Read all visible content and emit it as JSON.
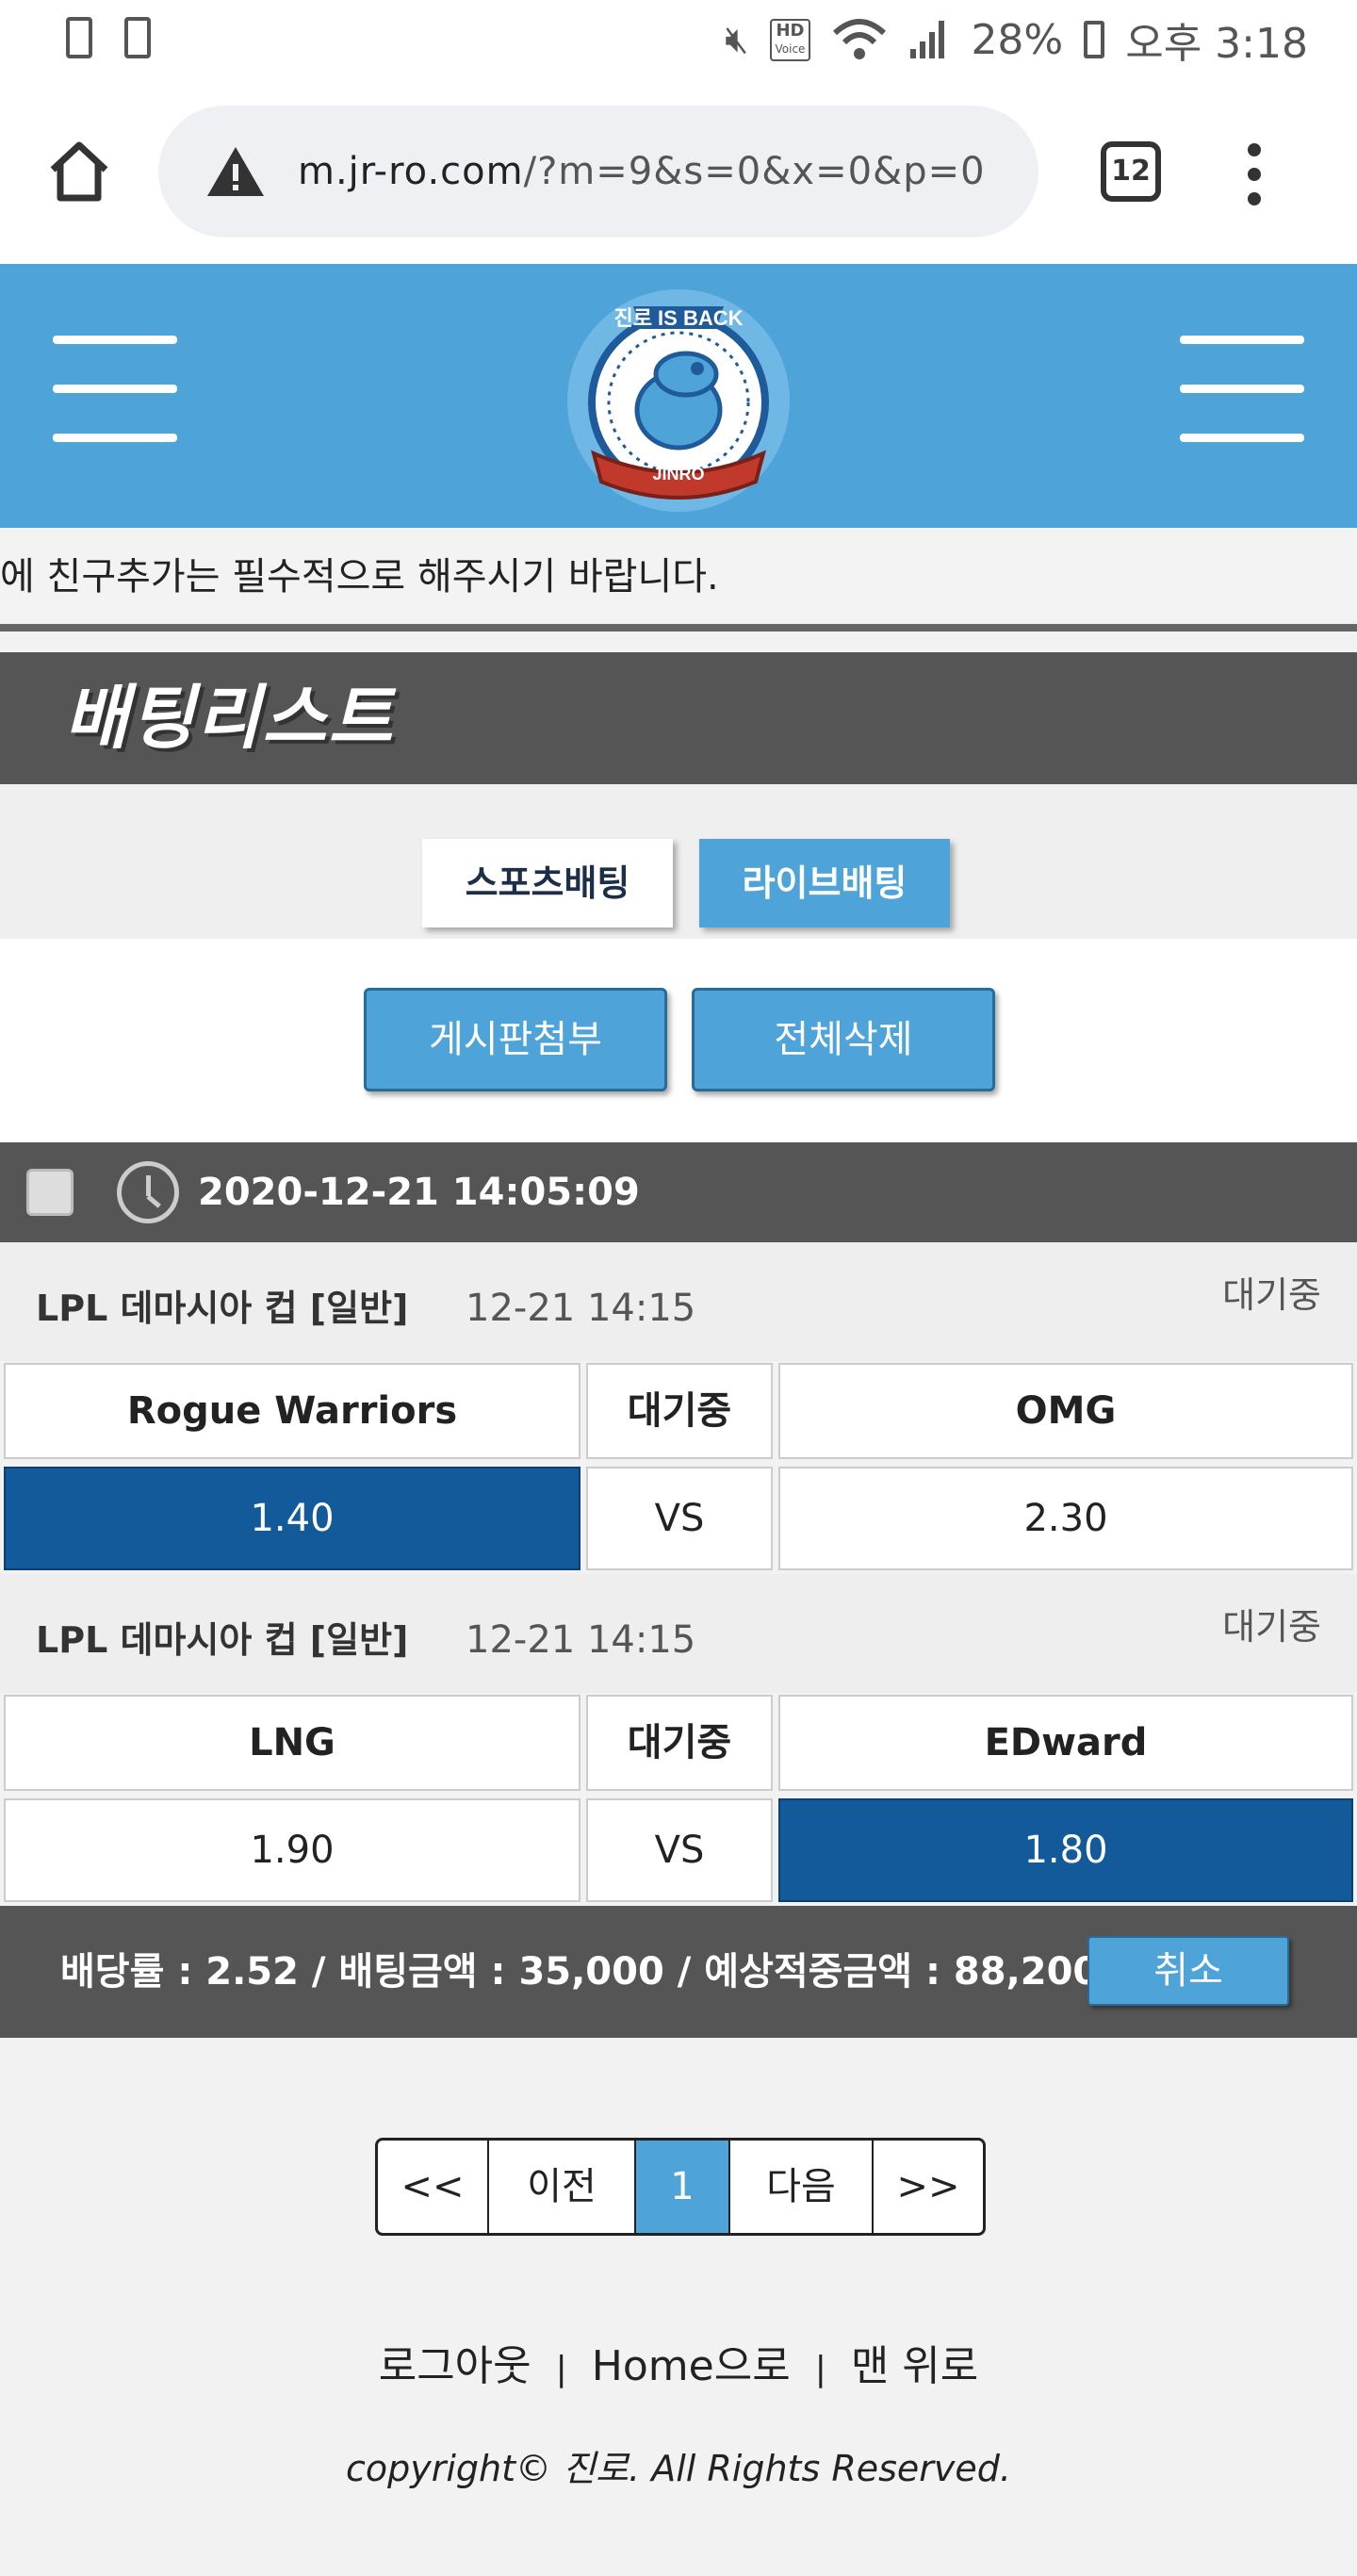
{
  "status_bar": {
    "battery": "28%",
    "time": "오후 3:18",
    "hd_label": "HD",
    "voice_label": "Voice"
  },
  "browser": {
    "url_host": "m.jr-ro.com",
    "url_rest": "/?m=9&s=0&x=0&p=0",
    "tab_count": "12"
  },
  "header": {
    "logo_top_text": "진로 IS BACK",
    "logo_ribbon_text": "JINRO"
  },
  "notice": "에 친구추가는 필수적으로 해주시기 바랍니다.",
  "page_title": "배팅리스트",
  "tabs": [
    {
      "label": "스포츠배팅",
      "active": false
    },
    {
      "label": "라이브배팅",
      "active": true
    }
  ],
  "actions": {
    "attach_label": "게시판첨부",
    "delete_all_label": "전체삭제"
  },
  "slip": {
    "datetime": "2020-12-21 14:05:09",
    "games": [
      {
        "league": "LPL 데마시아 컵  [일반]",
        "time": "12-21 14:15",
        "status": "대기중",
        "home": "Rogue Warriors",
        "mid": "대기중",
        "away": "OMG",
        "home_odds": "1.40",
        "vs": "VS",
        "away_odds": "2.30",
        "selected": "home"
      },
      {
        "league": "LPL 데마시아 컵  [일반]",
        "time": "12-21 14:15",
        "status": "대기중",
        "home": "LNG",
        "mid": "대기중",
        "away": "EDward",
        "home_odds": "1.90",
        "vs": "VS",
        "away_odds": "1.80",
        "selected": "away"
      }
    ],
    "summary": "배당률 : 2.52 / 배팅금액 : 35,000 / 예상적중금액 : 88,200",
    "cancel_label": "취소"
  },
  "pagination": {
    "first": "<<",
    "prev": "이전",
    "current": "1",
    "next": "다음",
    "last": ">>"
  },
  "footer": {
    "logout": "로그아웃",
    "sep": "|",
    "home": "Home으로",
    "top": "맨 위로",
    "copyright": "copyright© 진로. All Rights Reserved."
  },
  "colors": {
    "header_blue": "#4ea3d9",
    "selected_odds": "#135a9a",
    "dark_bar": "#555555"
  }
}
